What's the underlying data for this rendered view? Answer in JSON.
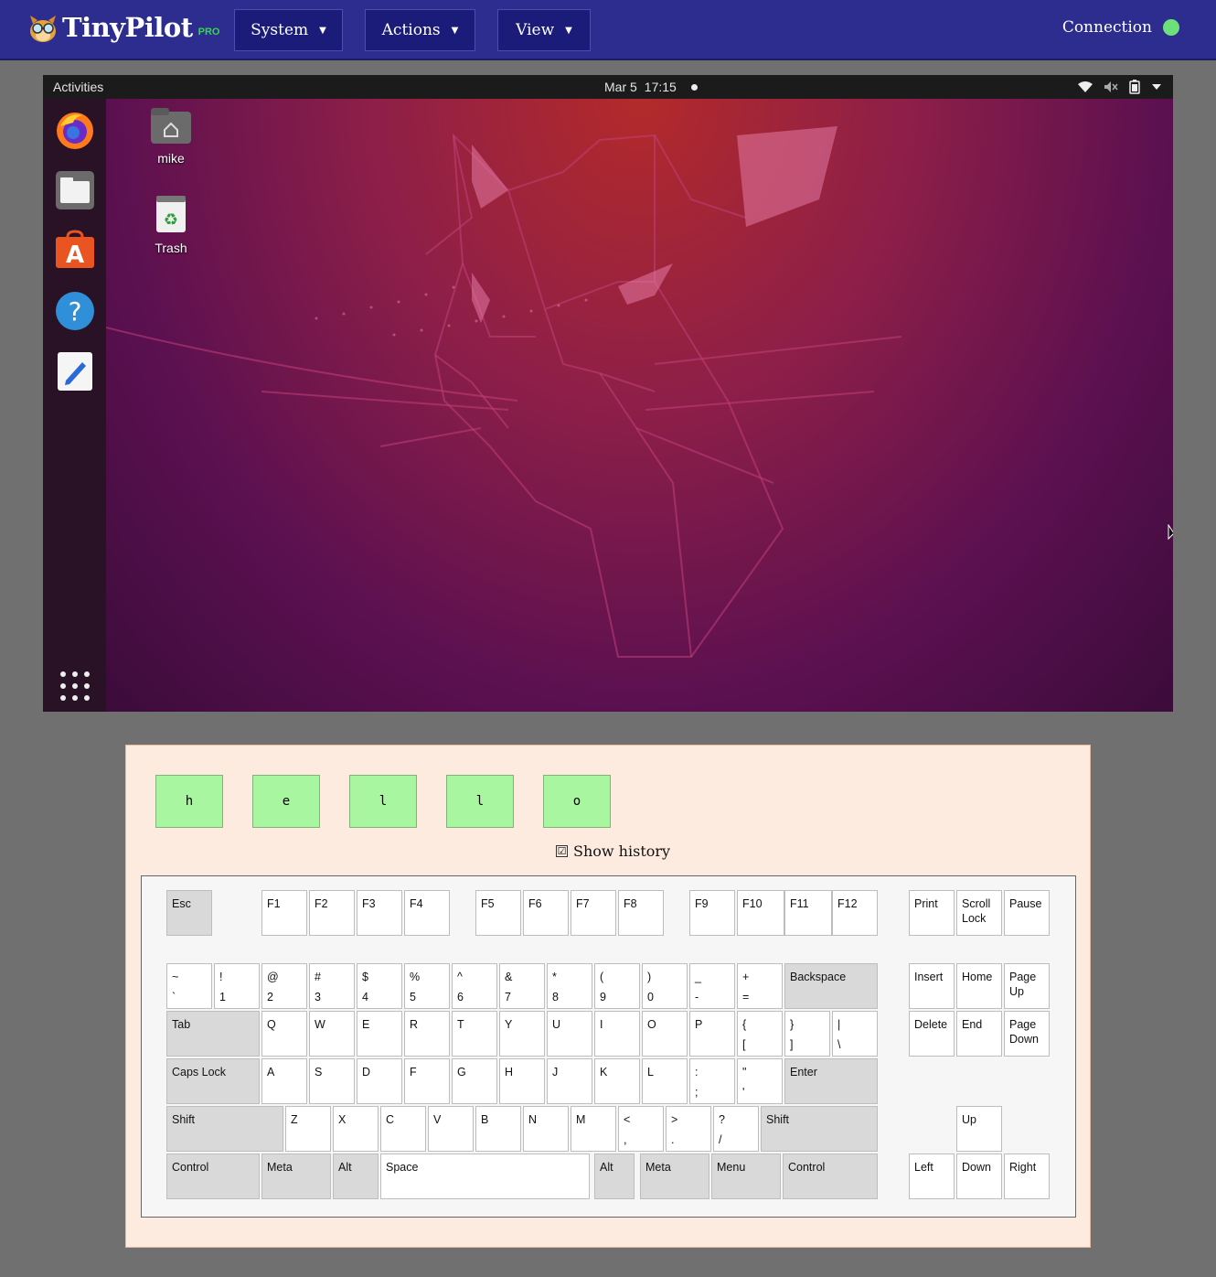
{
  "app": {
    "logo_text": "TinyPilot",
    "logo_badge": "PRO",
    "menus": [
      {
        "label": "System"
      },
      {
        "label": "Actions"
      },
      {
        "label": "View"
      }
    ],
    "connection_label": "Connection",
    "connection_color": "#6ee07a"
  },
  "remote": {
    "topbar": {
      "activities": "Activities",
      "date": "Mar 5",
      "time": "17:15"
    },
    "dock_icons": [
      "firefox-icon",
      "files-icon",
      "software-center-icon",
      "help-icon",
      "text-editor-icon",
      "apps-grid-icon"
    ],
    "desktop_icons": [
      {
        "label": "mike",
        "icon": "home-folder-icon"
      },
      {
        "label": "Trash",
        "icon": "trash-icon"
      }
    ]
  },
  "history": {
    "keys": [
      "h",
      "e",
      "l",
      "l",
      "o"
    ],
    "show_history_label": "Show history",
    "show_history_checked": "☑"
  },
  "keyboard": {
    "rows": [
      [
        {
          "label": "Esc",
          "mod": true
        },
        {
          "label": "F1"
        },
        {
          "label": "F2"
        },
        {
          "label": "F3"
        },
        {
          "label": "F4"
        },
        {
          "label": "F5"
        },
        {
          "label": "F6"
        },
        {
          "label": "F7"
        },
        {
          "label": "F8"
        },
        {
          "label": "F9"
        },
        {
          "label": "F10"
        },
        {
          "label": "F11"
        },
        {
          "label": "F12"
        },
        {
          "label": "Print"
        },
        {
          "label": "Scroll Lock"
        },
        {
          "label": "Pause"
        }
      ],
      [
        {
          "shift": "~",
          "base": "`"
        },
        {
          "shift": "!",
          "base": "1"
        },
        {
          "shift": "@",
          "base": "2"
        },
        {
          "shift": "#",
          "base": "3"
        },
        {
          "shift": "$",
          "base": "4"
        },
        {
          "shift": "%",
          "base": "5"
        },
        {
          "shift": "^",
          "base": "6"
        },
        {
          "shift": "&",
          "base": "7"
        },
        {
          "shift": "*",
          "base": "8"
        },
        {
          "shift": "(",
          "base": "9"
        },
        {
          "shift": ")",
          "base": "0"
        },
        {
          "shift": "_",
          "base": "-"
        },
        {
          "shift": "+",
          "base": "="
        },
        {
          "label": "Backspace",
          "mod": true
        },
        {
          "label": "Insert"
        },
        {
          "label": "Home"
        },
        {
          "label": "Page Up"
        }
      ],
      [
        {
          "label": "Tab",
          "mod": true
        },
        {
          "label": "Q"
        },
        {
          "label": "W"
        },
        {
          "label": "E"
        },
        {
          "label": "R"
        },
        {
          "label": "T"
        },
        {
          "label": "Y"
        },
        {
          "label": "U"
        },
        {
          "label": "I"
        },
        {
          "label": "O"
        },
        {
          "label": "P"
        },
        {
          "shift": "{",
          "base": "["
        },
        {
          "shift": "}",
          "base": "]"
        },
        {
          "shift": "|",
          "base": "\\"
        },
        {
          "label": "Delete"
        },
        {
          "label": "End"
        },
        {
          "label": "Page Down"
        }
      ],
      [
        {
          "label": "Caps Lock",
          "mod": true
        },
        {
          "label": "A"
        },
        {
          "label": "S"
        },
        {
          "label": "D"
        },
        {
          "label": "F"
        },
        {
          "label": "G"
        },
        {
          "label": "H"
        },
        {
          "label": "J"
        },
        {
          "label": "K"
        },
        {
          "label": "L"
        },
        {
          "shift": ":",
          "base": ";"
        },
        {
          "shift": "\"",
          "base": "'"
        },
        {
          "label": "Enter",
          "mod": true
        }
      ],
      [
        {
          "label": "Shift",
          "mod": true
        },
        {
          "label": "Z"
        },
        {
          "label": "X"
        },
        {
          "label": "C"
        },
        {
          "label": "V"
        },
        {
          "label": "B"
        },
        {
          "label": "N"
        },
        {
          "label": "M"
        },
        {
          "shift": "<",
          "base": ","
        },
        {
          "shift": ">",
          "base": "."
        },
        {
          "shift": "?",
          "base": "/"
        },
        {
          "label": "Shift",
          "mod": true
        },
        {
          "label": "Up"
        }
      ],
      [
        {
          "label": "Control",
          "mod": true
        },
        {
          "label": "Meta",
          "mod": true
        },
        {
          "label": "Alt",
          "mod": true
        },
        {
          "label": "Space"
        },
        {
          "label": "Alt",
          "mod": true
        },
        {
          "label": "Meta",
          "mod": true
        },
        {
          "label": "Menu",
          "mod": true
        },
        {
          "label": "Control",
          "mod": true
        },
        {
          "label": "Left"
        },
        {
          "label": "Down"
        },
        {
          "label": "Right"
        }
      ]
    ]
  }
}
